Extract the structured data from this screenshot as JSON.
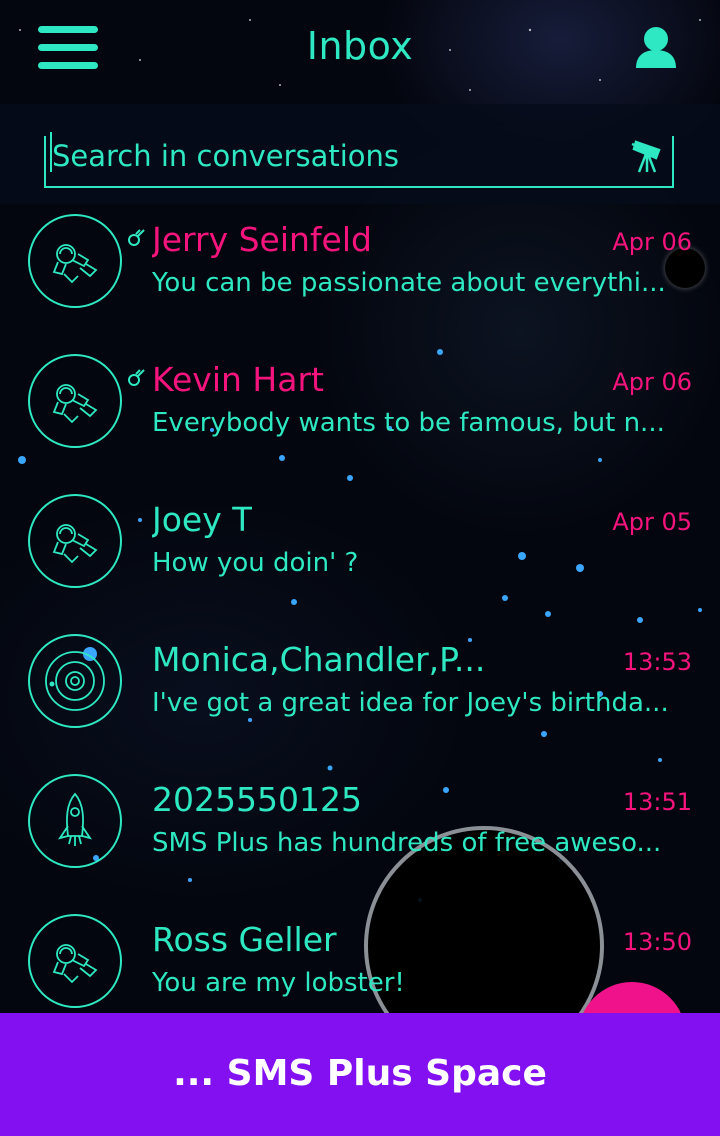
{
  "header": {
    "title": "Inbox",
    "menu_icon": "hamburger-menu-icon",
    "profile_icon": "user-icon"
  },
  "search": {
    "placeholder": "Search in conversations",
    "icon": "telescope-icon"
  },
  "conversations": [
    {
      "name": "Jerry Seinfeld",
      "date": "Apr 06",
      "preview": "You can be passionate about everythi...",
      "unread": true,
      "avatar_icon": "astronaut-icon"
    },
    {
      "name": "Kevin Hart",
      "date": "Apr 06",
      "preview": "Everybody wants to be famous, but n...",
      "unread": true,
      "avatar_icon": "astronaut-icon"
    },
    {
      "name": "Joey T",
      "date": "Apr 05",
      "preview": "How you doin' ?",
      "unread": false,
      "avatar_icon": "astronaut-icon"
    },
    {
      "name": "Monica,Chandler,P...",
      "date": "13:53",
      "preview": "I've got a great idea for Joey's birthda...",
      "unread": false,
      "avatar_icon": "solar-system-icon"
    },
    {
      "name": "2025550125",
      "date": "13:51",
      "preview": "SMS Plus has hundreds of free aweso...",
      "unread": false,
      "avatar_icon": "rocket-icon"
    },
    {
      "name": "Ross Geller",
      "date": "13:50",
      "preview": "You are my lobster!",
      "unread": false,
      "avatar_icon": "astronaut-icon"
    }
  ],
  "banner": {
    "text": "... SMS Plus Space"
  },
  "colors": {
    "accent": "#2de8c2",
    "unread": "#f5147e",
    "banner": "#8210f0",
    "fab": "#f0128a",
    "background": "#03060e"
  }
}
